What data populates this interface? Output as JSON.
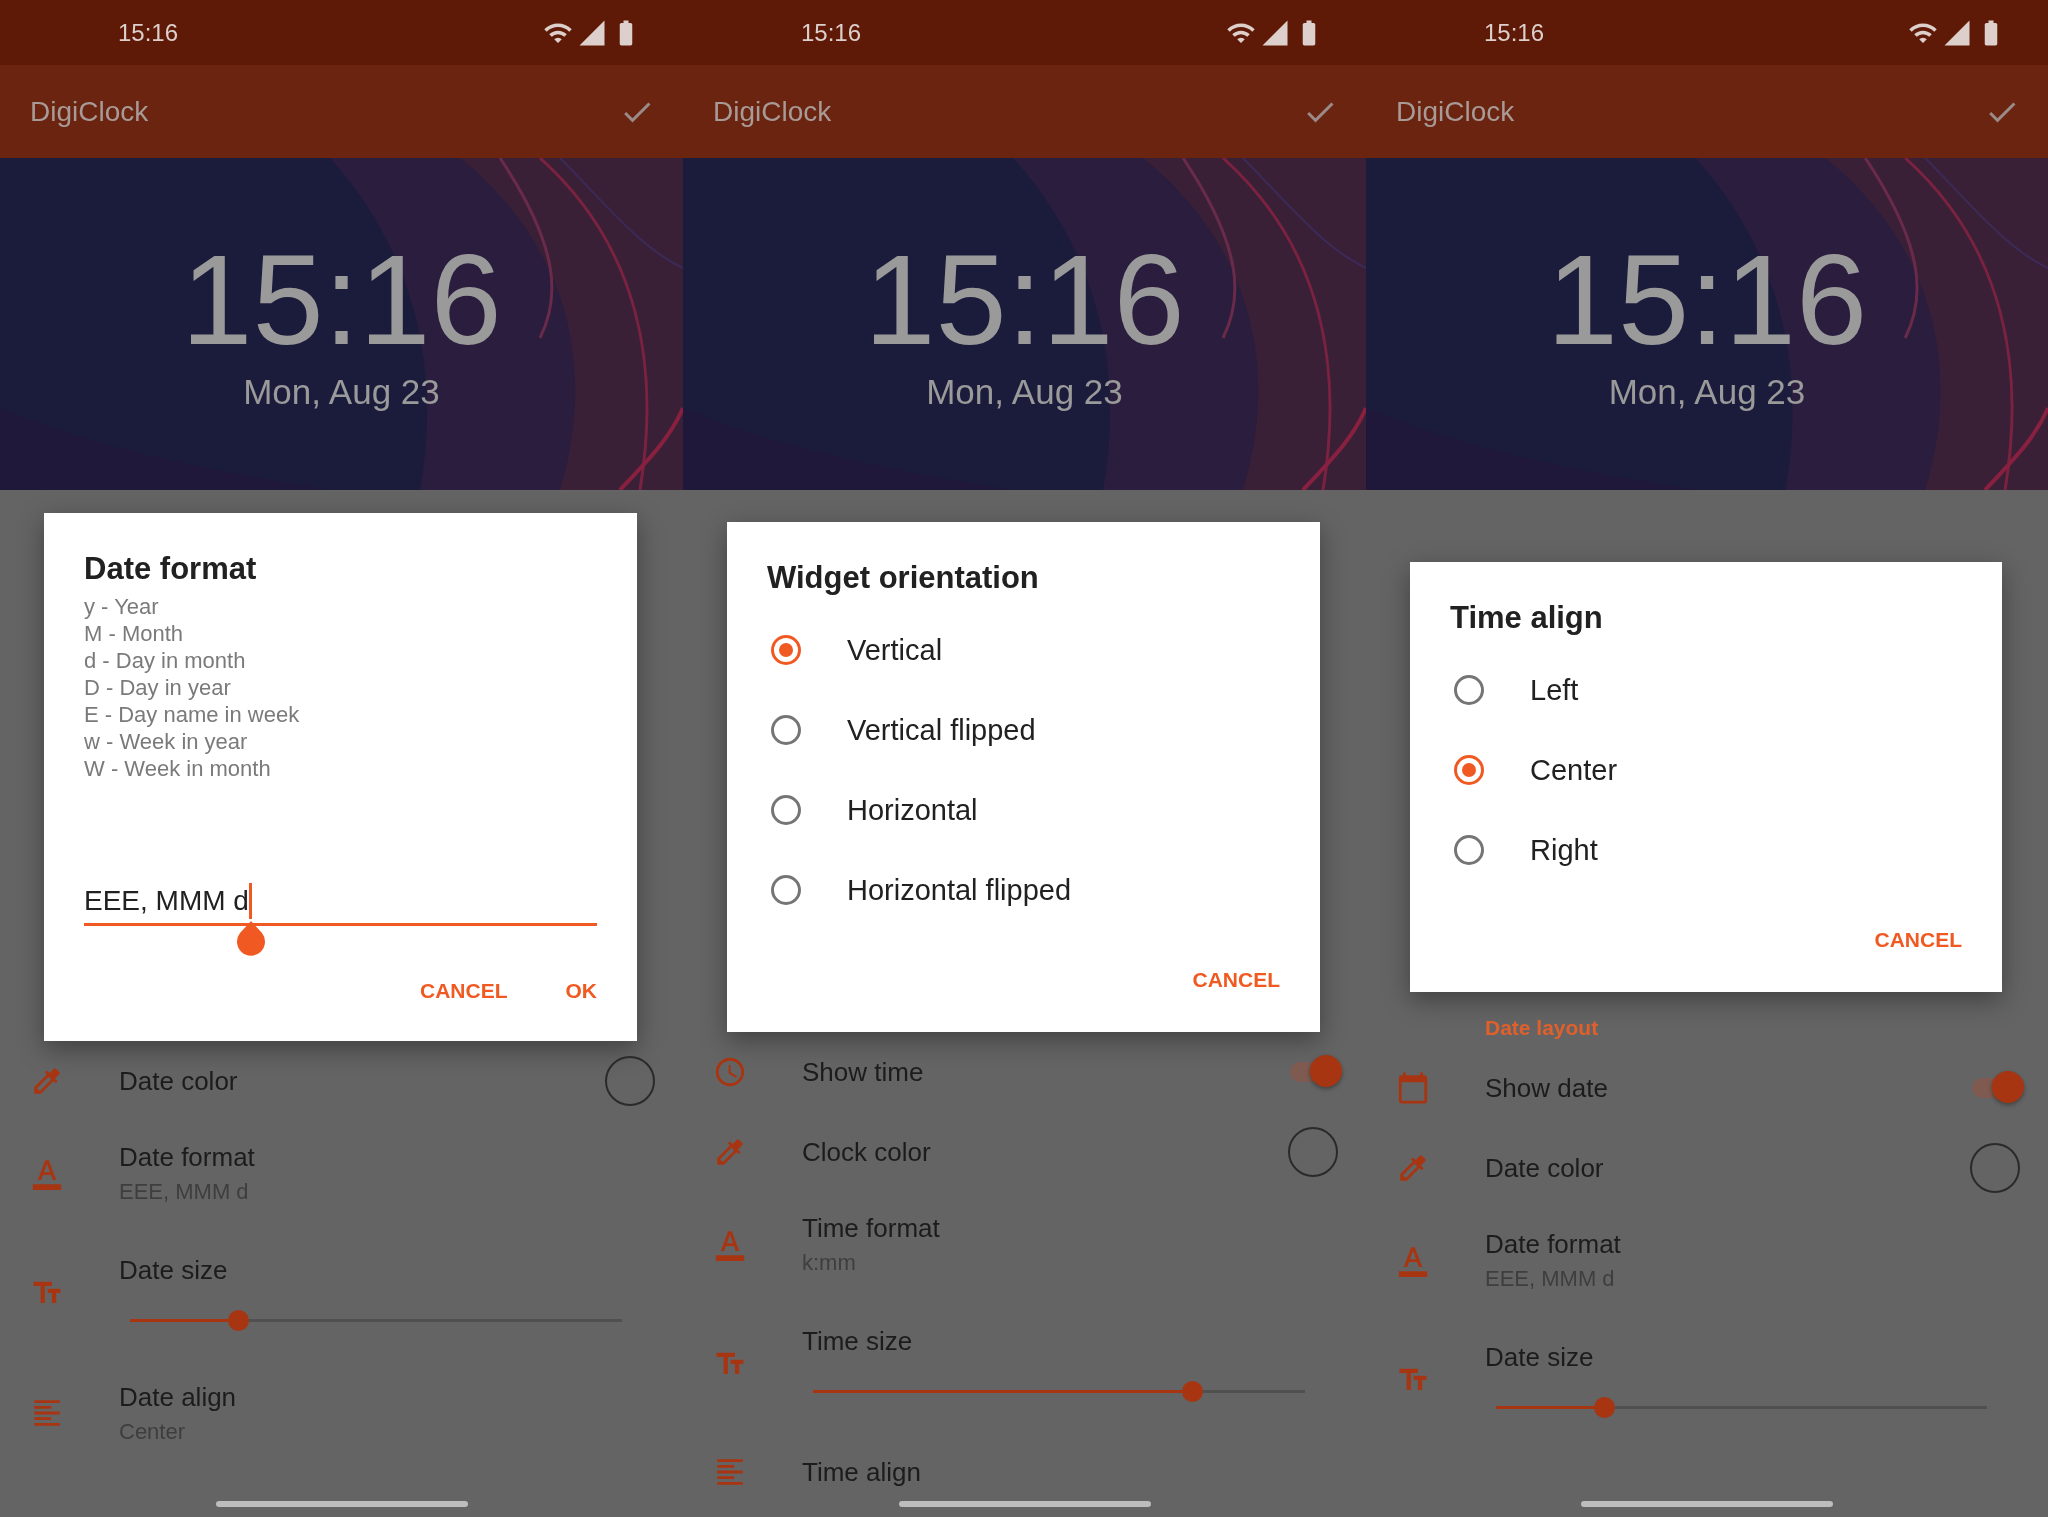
{
  "screens": [
    {
      "status_bar": {
        "time": "15:16"
      },
      "app_bar": {
        "title": "DigiClock"
      },
      "preview": {
        "time": "15:16",
        "date": "Mon, Aug 23"
      },
      "dialog": {
        "kind": "input",
        "title": "Date format",
        "help_lines": [
          "y - Year",
          "M - Month",
          "d - Day in month",
          "D - Day in year",
          "E - Day name in week",
          "w - Week in year",
          "W - Week in month"
        ],
        "value": "EEE, MMM d",
        "buttons": [
          "CANCEL",
          "OK"
        ]
      },
      "settings": [
        {
          "kind": "color",
          "title": "Date color"
        },
        {
          "kind": "format",
          "title": "Date format",
          "summary": "EEE, MMM d"
        },
        {
          "kind": "size",
          "title": "Date size",
          "level": 0.22
        },
        {
          "kind": "align",
          "title": "Date align",
          "summary": "Center"
        }
      ]
    },
    {
      "status_bar": {
        "time": "15:16"
      },
      "app_bar": {
        "title": "DigiClock"
      },
      "preview": {
        "time": "15:16",
        "date": "Mon, Aug 23"
      },
      "dialog": {
        "kind": "choice",
        "title": "Widget orientation",
        "options": [
          {
            "label": "Vertical",
            "selected": true
          },
          {
            "label": "Vertical flipped",
            "selected": false
          },
          {
            "label": "Horizontal",
            "selected": false
          },
          {
            "label": "Horizontal flipped",
            "selected": false
          }
        ],
        "buttons": [
          "CANCEL"
        ]
      },
      "settings": [
        {
          "kind": "showtime",
          "title": "Show time",
          "on": true
        },
        {
          "kind": "color",
          "title": "Clock color"
        },
        {
          "kind": "format",
          "title": "Time format",
          "summary": "k:mm"
        },
        {
          "kind": "size",
          "title": "Time size",
          "level": 0.77
        },
        {
          "kind": "align",
          "title": "Time align"
        }
      ]
    },
    {
      "status_bar": {
        "time": "15:16"
      },
      "app_bar": {
        "title": "DigiClock"
      },
      "preview": {
        "time": "15:16",
        "date": "Mon, Aug 23"
      },
      "dialog": {
        "kind": "choice",
        "title": "Time align",
        "options": [
          {
            "label": "Left",
            "selected": false
          },
          {
            "label": "Center",
            "selected": true
          },
          {
            "label": "Right",
            "selected": false
          }
        ],
        "buttons": [
          "CANCEL"
        ]
      },
      "settings": [
        {
          "kind": "header",
          "title": "Date layout"
        },
        {
          "kind": "showdate",
          "title": "Show date",
          "on": true
        },
        {
          "kind": "color",
          "title": "Date color"
        },
        {
          "kind": "format",
          "title": "Date format",
          "summary": "EEE, MMM d"
        },
        {
          "kind": "size",
          "title": "Date size",
          "level": 0.22
        }
      ]
    }
  ]
}
